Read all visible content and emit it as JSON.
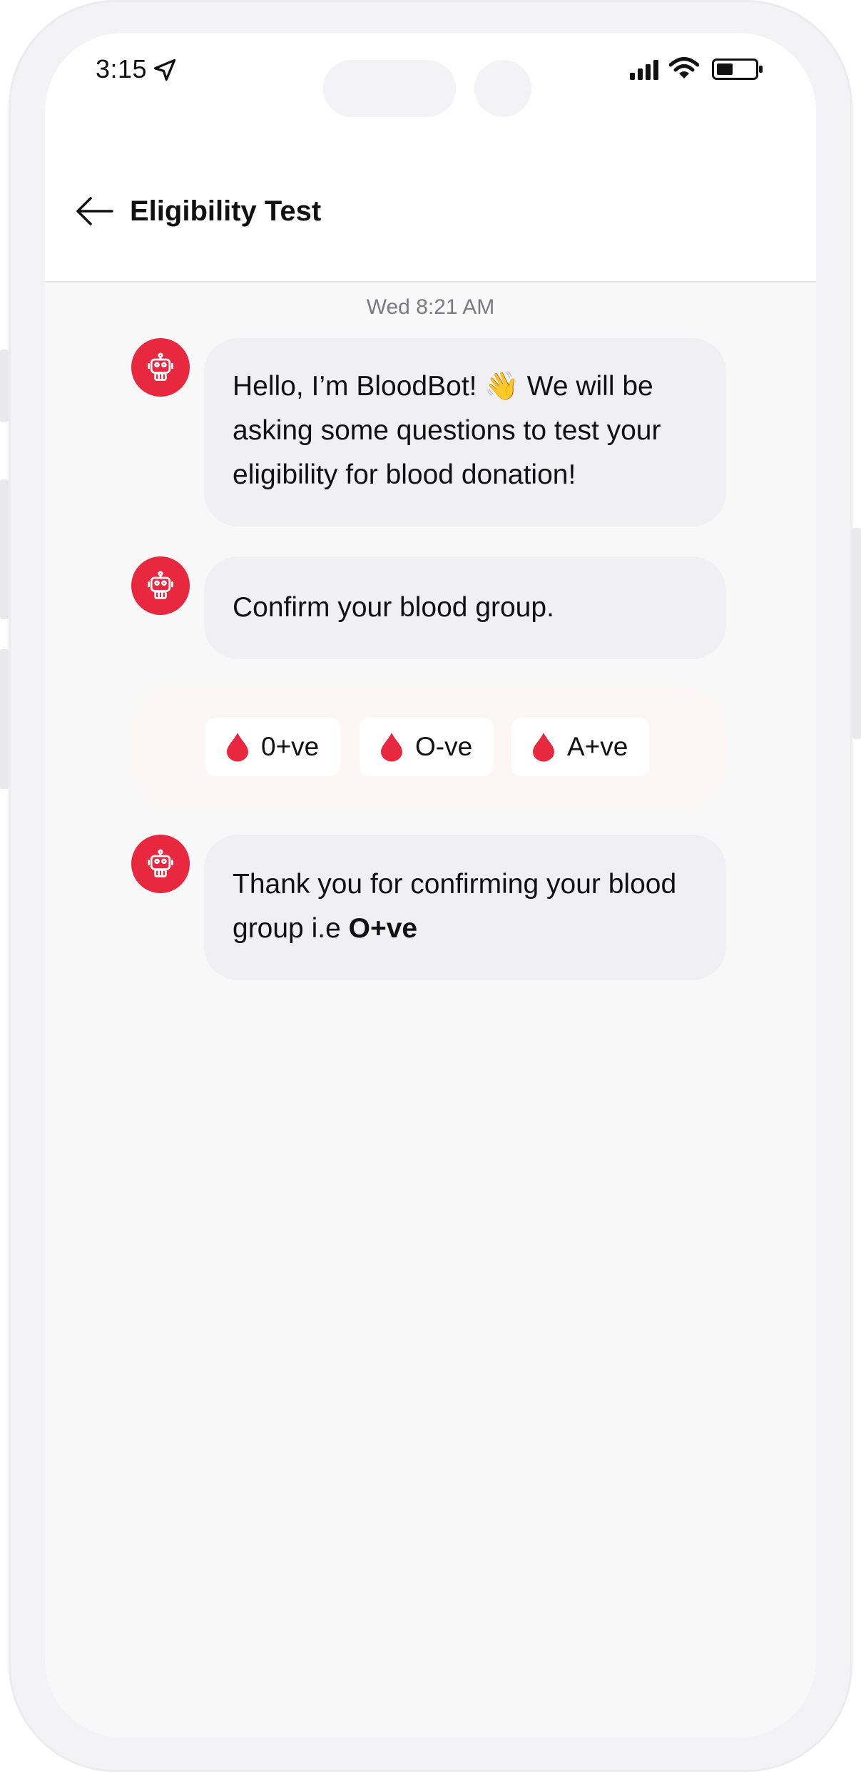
{
  "status_bar": {
    "time": "3:15",
    "icons": [
      "location-arrow-icon",
      "signal-icon",
      "wifi-icon",
      "battery-icon"
    ]
  },
  "header": {
    "title": "Eligibility Test",
    "back_icon": "arrow-left-icon"
  },
  "chat": {
    "timestamp": "Wed 8:21 AM",
    "bot_avatar_icon": "robot-icon",
    "messages": [
      {
        "text_before": "Hello, I’m BloodBot! ",
        "emoji": "👋",
        "text_after": " We will be asking some questions to test your eligibility for blood donation!"
      },
      {
        "text": "Confirm your blood group."
      },
      {
        "text": "Thank you for confirming your blood group i.e ",
        "bold": "O+ve"
      }
    ],
    "choices": [
      {
        "label": "0+ve",
        "icon": "blood-drop-icon"
      },
      {
        "label": "O-ve",
        "icon": "blood-drop-icon"
      },
      {
        "label": "A+ve",
        "icon": "blood-drop-icon"
      }
    ]
  },
  "colors": {
    "accent": "#e8283f",
    "bubble": "#f0f0f2",
    "choices_bg": "#fdf6f6",
    "screen_bg": "#f8f8f9"
  }
}
